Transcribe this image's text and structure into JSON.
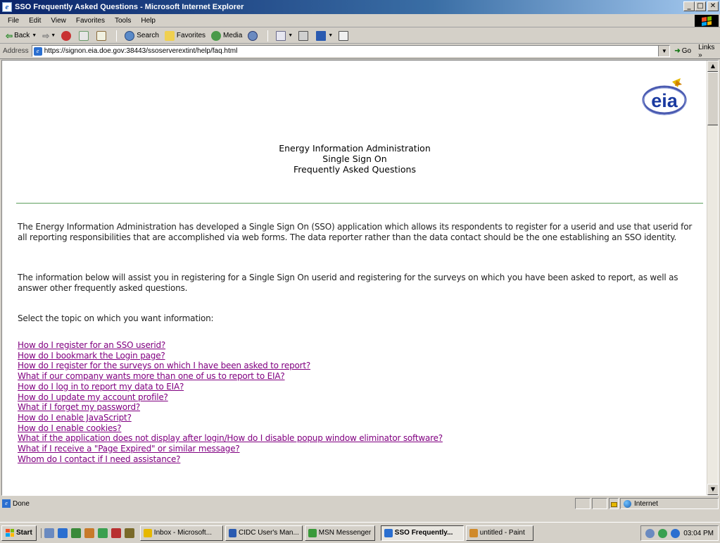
{
  "window": {
    "title": "SSO Frequently Asked Questions - Microsoft Internet Explorer",
    "minimize": "_",
    "maximize": "□",
    "close": "✕"
  },
  "menu": [
    "File",
    "Edit",
    "View",
    "Favorites",
    "Tools",
    "Help"
  ],
  "toolbar": {
    "back": "Back",
    "search": "Search",
    "favorites": "Favorites",
    "media": "Media"
  },
  "address": {
    "label": "Address",
    "url": "https://signon.eia.doe.gov:38443/ssoserverextint/help/faq.html",
    "go": "Go",
    "links": "Links »"
  },
  "page": {
    "logo_text": "eia",
    "header_lines": [
      "Energy Information Administration",
      "Single Sign On",
      "Frequently Asked Questions"
    ],
    "paragraphs": [
      "The Energy Information Administration has developed a Single Sign On (SSO) application which allows its respondents to register for a userid and use that userid for all reporting responsibilities that are accomplished via web forms. The data reporter rather than the data contact should be the one establishing an SSO identity.",
      "The information below will assist you in registering for a Single Sign On userid and registering for the surveys on which you have been asked to report, as well as answer other frequently asked questions.",
      "Select the topic on which you want information:"
    ],
    "links": [
      "How do I register for an SSO userid?",
      "How do I bookmark the Login page?",
      "How do I register for the surveys on which I have been asked to report?",
      "What if our company wants more than one of us to report to EIA?",
      "How do I log in to report my data to EIA?",
      "How do I update my account profile?",
      "What if I forget my password?",
      "How do I enable JavaScript?",
      "How do I enable cookies?",
      "What if the application does not display after login/How do I disable popup window eliminator software?",
      "What if I receive a \"Page Expired\" or similar message?",
      "Whom do I contact if I need assistance?"
    ],
    "link_color": "#800080",
    "rule_color": "#5ea05e"
  },
  "status": {
    "text": "Done",
    "zone": "Internet"
  },
  "taskbar": {
    "start": "Start",
    "tasks": [
      {
        "label": "Inbox - Microsoft...",
        "active": false
      },
      {
        "label": "CIDC User's Man...",
        "active": false
      },
      {
        "label": "MSN Messenger",
        "active": false
      },
      {
        "label": "SSO Frequently...",
        "active": true
      },
      {
        "label": "untitled - Paint",
        "active": false
      }
    ],
    "clock": "03:04 PM"
  }
}
